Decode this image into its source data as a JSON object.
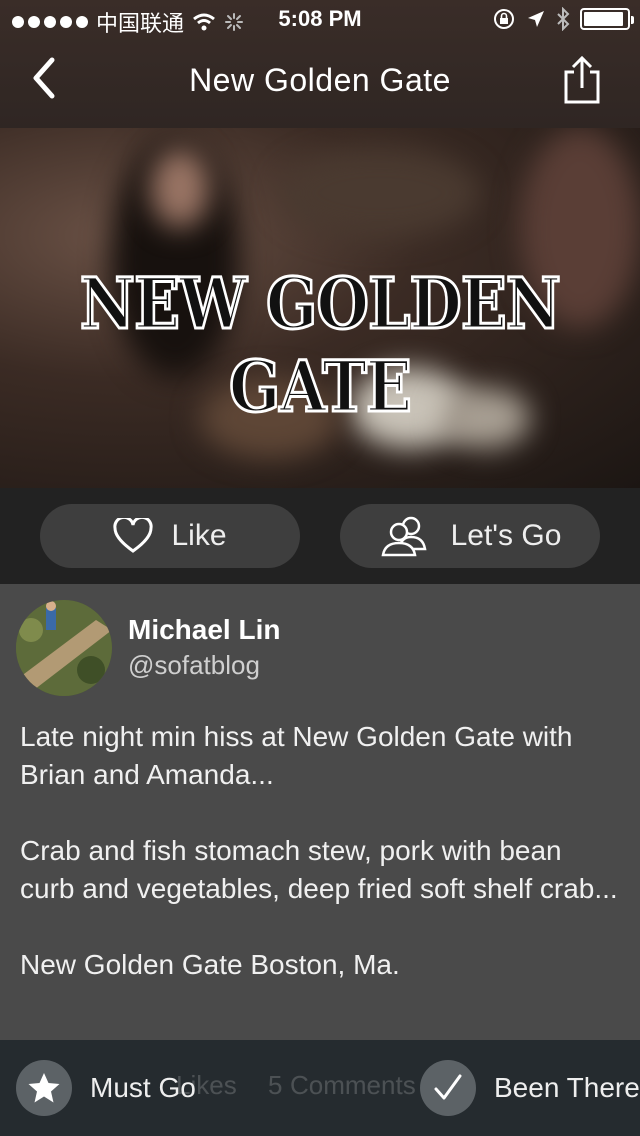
{
  "status_bar": {
    "carrier": "中国联通",
    "time": "5:08 PM",
    "battery_level": 0.92
  },
  "nav": {
    "title": "New Golden Gate",
    "back_icon": "chevron-left-icon",
    "share_icon": "share-icon"
  },
  "hero": {
    "overlay_title": "NEW GOLDEN GATE"
  },
  "actions": {
    "like_label": "Like",
    "lets_go_label": "Let's Go"
  },
  "post": {
    "author_name": "Michael Lin",
    "author_handle": "@sofatblog",
    "paragraphs": [
      "Late night min hiss at New Golden Gate with Brian and Amanda...",
      "Crab and fish stomach stew, pork with bean curb and vegetables, deep fried soft shelf crab...",
      "New Golden Gate Boston, Ma."
    ]
  },
  "bottom_bar": {
    "must_go_label": "Must Go",
    "been_there_label": "Been There",
    "likes_text": "Likes",
    "comments_count": "5",
    "comments_text": "Comments"
  },
  "colors": {
    "header_bg": "#2f2623",
    "action_bar_bg": "#222222",
    "pill_bg": "#3e3e3e",
    "post_bg": "#4a4a4a",
    "bottom_bar_bg": "#232a2e"
  }
}
